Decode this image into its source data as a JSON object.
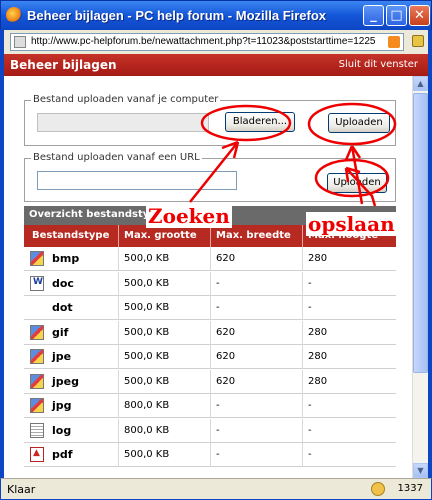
{
  "window": {
    "title": "Beheer bijlagen - PC help forum - Mozilla Firefox",
    "url": "http://www.pc-helpforum.be/newattachment.php?t=11023&poststarttime=1225",
    "minimize": "_",
    "maximize": "□",
    "close": "✕"
  },
  "header": {
    "title": "Beheer bijlagen",
    "close_link": "Sluit dit venster"
  },
  "upload_computer": {
    "legend": "Bestand uploaden vanaf je computer",
    "browse_label": "Bladeren...",
    "upload_label": "Uploaden"
  },
  "upload_url": {
    "legend": "Bestand uploaden vanaf een URL",
    "value": "",
    "upload_label": "Uploaden"
  },
  "overview": {
    "title": "Overzicht bestandstype"
  },
  "table": {
    "headers": [
      "Bestandstype",
      "Max. grootte",
      "Max. breedte",
      "Max. hoogte"
    ],
    "rows": [
      {
        "icon": "image-file-icon",
        "type": "bmp",
        "size": "500,0 KB",
        "width": "620",
        "height": "280"
      },
      {
        "icon": "word-doc-icon",
        "type": "doc",
        "size": "500,0 KB",
        "width": "-",
        "height": "-"
      },
      {
        "icon": "",
        "type": "dot",
        "size": "500,0 KB",
        "width": "-",
        "height": "-"
      },
      {
        "icon": "image-file-icon",
        "type": "gif",
        "size": "500,0 KB",
        "width": "620",
        "height": "280"
      },
      {
        "icon": "image-file-icon",
        "type": "jpe",
        "size": "500,0 KB",
        "width": "620",
        "height": "280"
      },
      {
        "icon": "image-file-icon",
        "type": "jpeg",
        "size": "500,0 KB",
        "width": "620",
        "height": "280"
      },
      {
        "icon": "image-file-icon",
        "type": "jpg",
        "size": "800,0 KB",
        "width": "-",
        "height": "-"
      },
      {
        "icon": "text-file-icon",
        "type": "log",
        "size": "800,0 KB",
        "width": "-",
        "height": "-"
      },
      {
        "icon": "pdf-file-icon",
        "type": "pdf",
        "size": "500,0 KB",
        "width": "-",
        "height": "-"
      }
    ]
  },
  "annotations": {
    "zoeken": "Zoeken",
    "opslaan": "opslaan",
    "color": "#e00000"
  },
  "status": {
    "text": "Klaar",
    "count": "1337"
  },
  "colors": {
    "titlebar": "#1456d8",
    "header_red": "#b62a22",
    "overview_gray": "#6a6a6a"
  }
}
